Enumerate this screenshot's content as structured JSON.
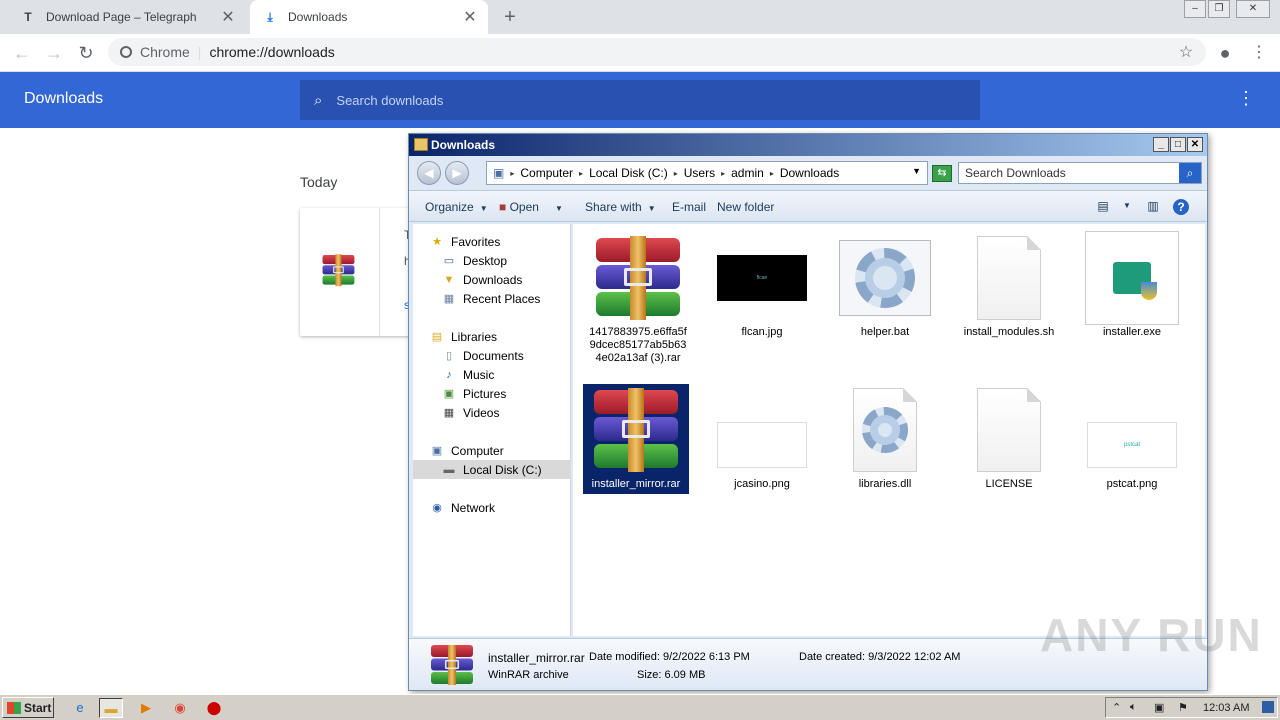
{
  "chrome": {
    "tabs": [
      {
        "label": "Download Page – Telegraph",
        "favicon": "T"
      },
      {
        "label": "Downloads",
        "favicon": "download-icon"
      }
    ],
    "omnibox": {
      "site": "Chrome",
      "url": "chrome://downloads"
    }
  },
  "downloads_page": {
    "title": "Downloads",
    "search_placeholder": "Search downloads",
    "section": "Today",
    "card_partial": [
      "T",
      "h",
      "s"
    ]
  },
  "explorer": {
    "title": "Downloads",
    "breadcrumb": [
      "Computer",
      "Local Disk (C:)",
      "Users",
      "admin",
      "Downloads"
    ],
    "search_placeholder": "Search Downloads",
    "commands": {
      "organize": "Organize",
      "open": "Open",
      "share": "Share with",
      "email": "E-mail",
      "new_folder": "New folder"
    },
    "nav": {
      "favorites": "Favorites",
      "desktop": "Desktop",
      "downloads": "Downloads",
      "recent": "Recent Places",
      "libraries": "Libraries",
      "documents": "Documents",
      "music": "Music",
      "pictures": "Pictures",
      "videos": "Videos",
      "computer": "Computer",
      "localdisk": "Local Disk (C:)",
      "network": "Network"
    },
    "files": [
      {
        "name": "1417883975.e6ffa5f9dcec85177ab5b634e02a13af (3).rar",
        "type": "rar"
      },
      {
        "name": "flcan.jpg",
        "type": "image-dark"
      },
      {
        "name": "helper.bat",
        "type": "gear"
      },
      {
        "name": "install_modules.sh",
        "type": "doc"
      },
      {
        "name": "installer.exe",
        "type": "installer"
      },
      {
        "name": "installer_mirror.rar",
        "type": "rar",
        "selected": true
      },
      {
        "name": "jcasino.png",
        "type": "image-light"
      },
      {
        "name": "libraries.dll",
        "type": "gear"
      },
      {
        "name": "LICENSE",
        "type": "doc"
      },
      {
        "name": "pstcat.png",
        "type": "image-light"
      }
    ],
    "flcan_thumb_text": "flcan",
    "pstcat_thumb_text": "pstcat",
    "details": {
      "name": "installer_mirror.rar",
      "kind": "WinRAR archive",
      "modified": "Date modified: 9/2/2022 6:13 PM",
      "size": "Size: 6.09 MB",
      "created": "Date created: 9/3/2022 12:02 AM"
    }
  },
  "taskbar": {
    "start": "Start",
    "clock": "12:03 AM"
  },
  "watermark": "ANY RUN",
  "colors": {
    "chrome_header": "#3367d6",
    "selection": "#0a246a"
  }
}
